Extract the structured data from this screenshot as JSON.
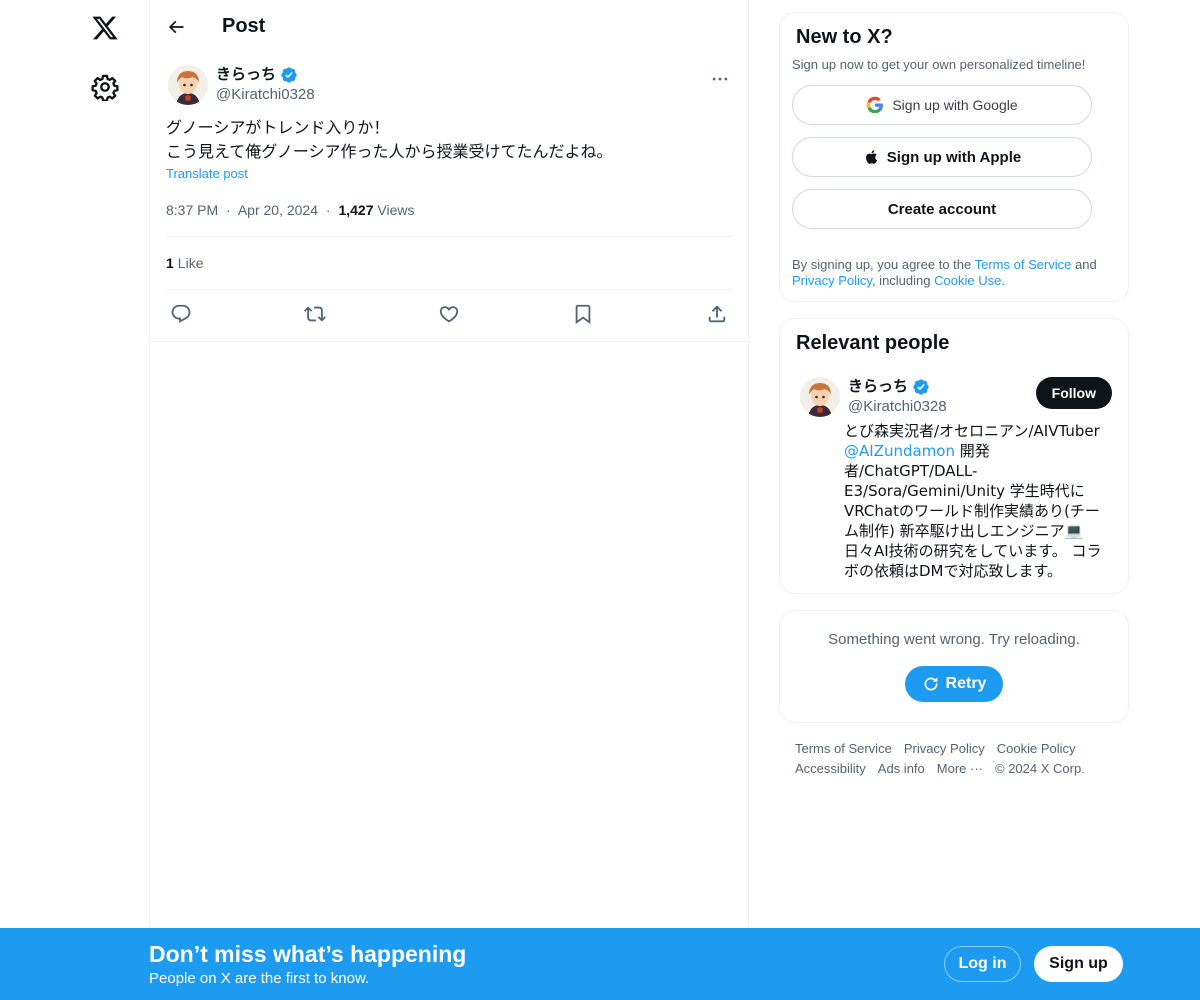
{
  "nav": {
    "logo_icon": "x-logo-icon",
    "settings_icon": "gear-icon"
  },
  "header": {
    "title": "Post",
    "back_icon": "arrow-left-icon"
  },
  "post": {
    "author_name": "きらっち",
    "handle": "@Kiratchi0328",
    "text": "グノーシアがトレンド入りか！\nこう見えて俺グノーシア作った人から授業受けてたんだよね。",
    "translate": "Translate post",
    "time": "8:37 PM",
    "date": "Apr 20, 2024",
    "views_count": "1,427",
    "views_label": "Views",
    "likes_count": "1",
    "likes_label": "Like",
    "dot": "·"
  },
  "signup": {
    "title": "New to X?",
    "subtitle": "Sign up now to get your own personalized timeline!",
    "google": "Sign up with Google",
    "apple": "Sign up with Apple",
    "create": "Create account",
    "legal_1": "By signing up, you agree to the ",
    "terms": "Terms of Service",
    "legal_2": " and ",
    "privacy": "Privacy Policy",
    "legal_3": ", including ",
    "cookie": "Cookie Use",
    "legal_4": "."
  },
  "relevant": {
    "title": "Relevant people",
    "name": "きらっち",
    "handle": "@Kiratchi0328",
    "follow": "Follow",
    "bio_1": "とび森実況者/オセロニアン/AIVTuber ",
    "bio_mention": "@AIZundamon",
    "bio_2": " 開発者/ChatGPT/DALL-E3/Sora/Gemini/Unity 学生時代にVRChatのワールド制作実績あり(チーム制作) 新卒駆け出しエンジニア💻 日々AI技術の研究をしています。 コラボの依頼はDMで対応致します。"
  },
  "error": {
    "message": "Something went wrong. Try reloading.",
    "retry": "Retry"
  },
  "footer": {
    "links_row1": [
      "Terms of Service",
      "Privacy Policy",
      "Cookie Policy"
    ],
    "links_row2": [
      "Accessibility",
      "Ads info",
      "More ···",
      "© 2024 X Corp."
    ]
  },
  "bottom": {
    "title": "Don’t miss what’s happening",
    "subtitle": "People on X are the first to know.",
    "login": "Log in",
    "signup": "Sign up"
  },
  "colors": {
    "accent": "#1d9bf0",
    "text": "#0f1419",
    "muted": "#536471",
    "border": "#eff3f4"
  }
}
